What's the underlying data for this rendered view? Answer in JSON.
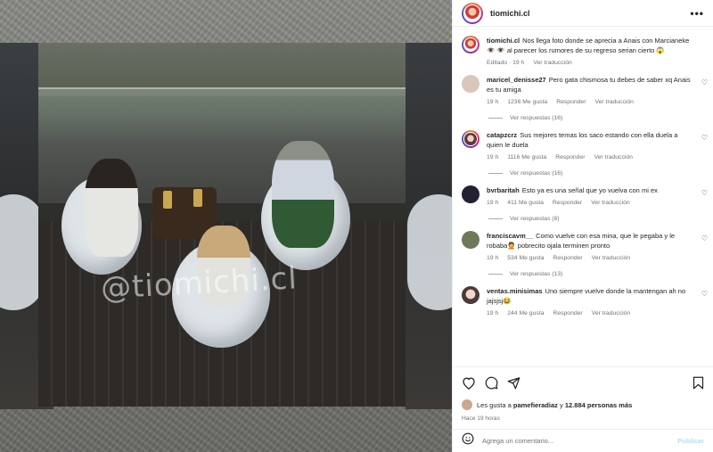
{
  "post": {
    "username": "tiomichi.cl",
    "more": "•••",
    "caption_user": "tiomichi.cl",
    "caption": "Nos llega foto donde se aprecia a Anais con Marcianeke 👁️ 👁️ al parecer los rumores de su regreso serian cierto 😱",
    "edited": "Editado · 19 h",
    "see_translation": "Ver traducción",
    "watermark": "@tiomichi.cl"
  },
  "comments": [
    {
      "user": "maricel_denisse27",
      "text": "Pero gata chismosa tu debes de saber xq Anais es tu amiga",
      "time": "19 h",
      "likes": "1236 Me gusta",
      "reply": "Responder",
      "translate": "Ver traducción",
      "replies": "Ver respuestas (16)"
    },
    {
      "user": "catapzcrz",
      "text": "Sus mejores temas los saco estando con ella duela a quien le duela",
      "time": "19 h",
      "likes": "1116 Me gusta",
      "reply": "Responder",
      "translate": "Ver traducción",
      "replies": "Ver respuestas (16)"
    },
    {
      "user": "bvrbaritah",
      "text": "Esto ya es una señal que yo vuelva con mi ex",
      "time": "19 h",
      "likes": "411 Me gusta",
      "reply": "Responder",
      "translate": "Ver traducción",
      "replies": "Ver respuestas (8)"
    },
    {
      "user": "franciscavm__",
      "text": "Como vuelve con esa mina, que le pegaba y le robaba🤦 pobrecito ojala terminen pronto",
      "time": "19 h",
      "likes": "534 Me gusta",
      "reply": "Responder",
      "translate": "Ver traducción",
      "replies": "Ver respuestas (13)"
    },
    {
      "user": "ventas.minisimas",
      "text": "Uno siempre vuelve donde la mantengan ah no jajsjsj😂",
      "time": "19 h",
      "likes": "244 Me gusta",
      "reply": "Responder",
      "translate": "Ver traducción",
      "replies": ""
    }
  ],
  "footer": {
    "likes_prefix": "Les gusta a",
    "likes_user": "pamefieradiaz",
    "likes_suffix": "y",
    "likes_count": "12.884 personas más",
    "ago": "Hace 19 horas",
    "comment_placeholder": "Agrega un comentario...",
    "post_label": "Publicar"
  },
  "icons": {
    "like": "heart-icon",
    "comment": "comment-icon",
    "share": "share-icon",
    "save": "bookmark-icon",
    "emoji": "emoji-icon"
  }
}
